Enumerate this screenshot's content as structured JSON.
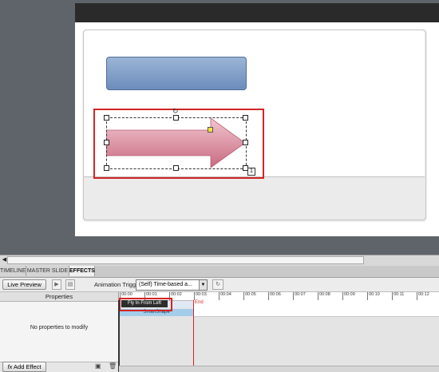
{
  "window": {
    "colors": {
      "stage_bg": "#5f636a",
      "selection_red": "#d32424",
      "end_red": "#dd2222"
    }
  },
  "slide": {
    "shapes": [
      {
        "name": "rounded-rectangle",
        "fill": "#7d9cc7"
      },
      {
        "name": "arrow-smartshape",
        "fill": "#d9889a"
      }
    ]
  },
  "tabs": [
    "TIMELINE",
    "MASTER SLIDE",
    "EFFECTS"
  ],
  "active_tab": "EFFECTS",
  "toolbar": {
    "live_preview": "Live Preview",
    "play_icon": "play-icon",
    "settings_icon": "filmstrip-icon",
    "trigger_label": "Animation Trigger:",
    "trigger_value": "(Self) Time-based a...",
    "refresh_icon": "loop-icon"
  },
  "properties": {
    "header": "Properties",
    "empty_message": "No properties to modify",
    "add_effect": "Add Effect",
    "fx_icon": "fx-icon",
    "footer_icons": [
      "save-icon",
      "delete-icon"
    ]
  },
  "timeline": {
    "ticks": [
      "00:00",
      "00:01",
      "00:02",
      "00:03",
      "00:04",
      "00:05",
      "00:06",
      "00:07",
      "00:08",
      "00:09",
      "00:10",
      "00:11",
      "00:12"
    ],
    "end_label": "End",
    "effect_label": "Fly In From Left",
    "object_label": "SmartShape"
  }
}
